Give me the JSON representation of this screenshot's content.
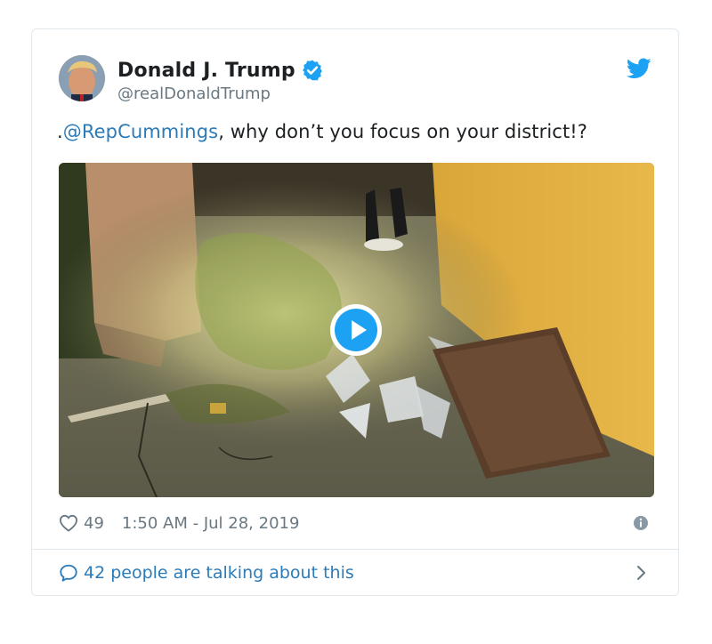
{
  "tweet": {
    "author": {
      "display_name": "Donald J. Trump",
      "handle": "@realDonaldTrump",
      "verified": true
    },
    "text": {
      "prefix": ".",
      "mention": "@RepCummings",
      "body": ", why don’t you focus on your district!?"
    },
    "media": {
      "type": "video",
      "icon": "play-icon"
    },
    "likes": "49",
    "timestamp": "1:50 AM - Jul 28, 2019",
    "footer": {
      "conversation_text": "42 people are talking about this"
    }
  },
  "colors": {
    "accent": "#1da1f2",
    "link": "#2b7bb9",
    "muted": "#697882",
    "border": "#e1e8ed"
  },
  "icons": [
    "twitter-bird-icon",
    "verified-badge-icon",
    "heart-icon",
    "info-icon",
    "speech-bubble-icon",
    "chevron-right-icon",
    "play-icon"
  ]
}
